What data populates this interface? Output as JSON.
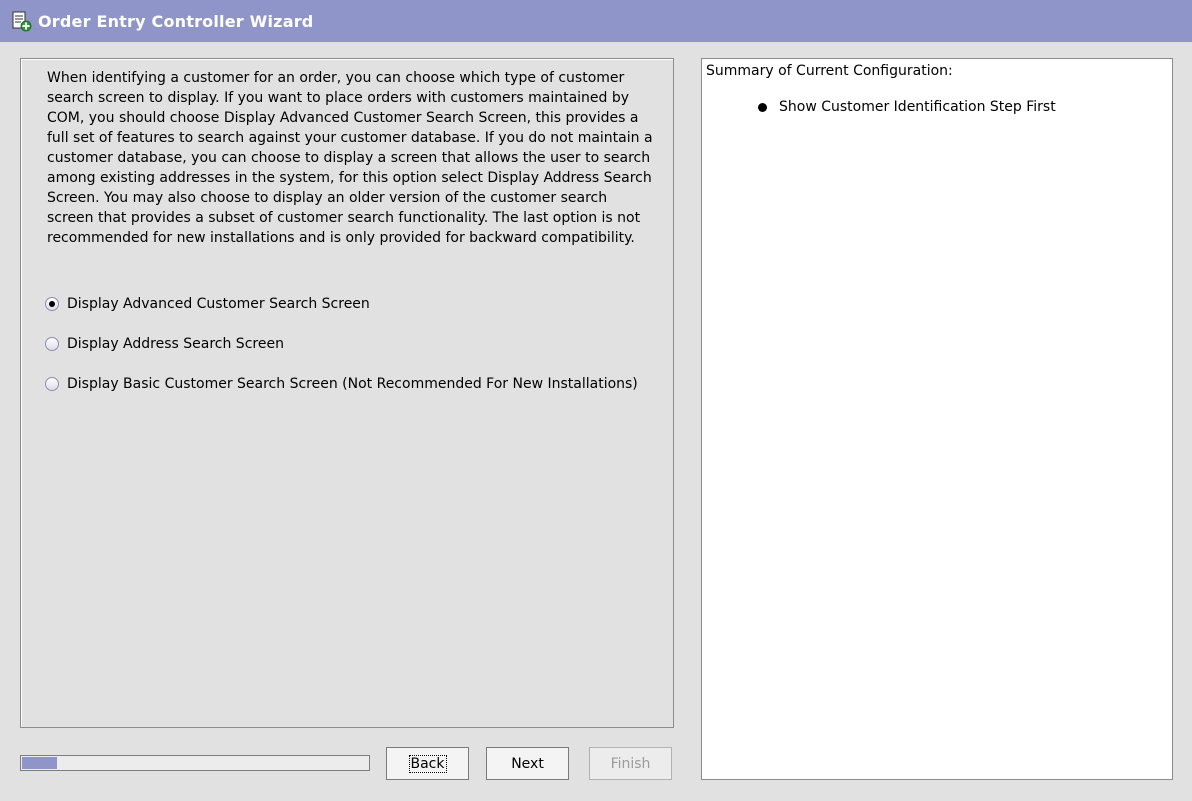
{
  "window": {
    "title": "Order Entry Controller Wizard",
    "icon": "document-plus-icon"
  },
  "main": {
    "description": "When identifying a customer for an order, you can choose which type of customer search screen to display. If you want to place orders with customers maintained by COM, you should choose Display Advanced Customer Search Screen, this provides a full set of features to search against your customer database. If you do not maintain a customer database, you can choose to display a screen that allows the user to search among existing addresses in the system, for this option select Display Address Search Screen.  You may also choose to display an older version of the customer search screen that provides a subset of customer search functionality. The last option is not recommended for new installations and is only provided for backward compatibility.",
    "options": [
      {
        "label": "Display Advanced Customer Search Screen",
        "selected": true
      },
      {
        "label": "Display Address Search Screen",
        "selected": false
      },
      {
        "label": "Display Basic Customer Search Screen (Not Recommended For New Installations)",
        "selected": false
      }
    ]
  },
  "footer": {
    "progress_fraction": 0.1,
    "back_label": "Back",
    "next_label": "Next",
    "finish_label": "Finish",
    "finish_enabled": false
  },
  "summary": {
    "heading": "Summary of Current Configuration:",
    "items": [
      "Show Customer Identification Step First"
    ]
  },
  "colors": {
    "title_bar": "#8f95c9",
    "progress_fill": "#8f95c9",
    "panel_background": "#e1e1e1"
  }
}
